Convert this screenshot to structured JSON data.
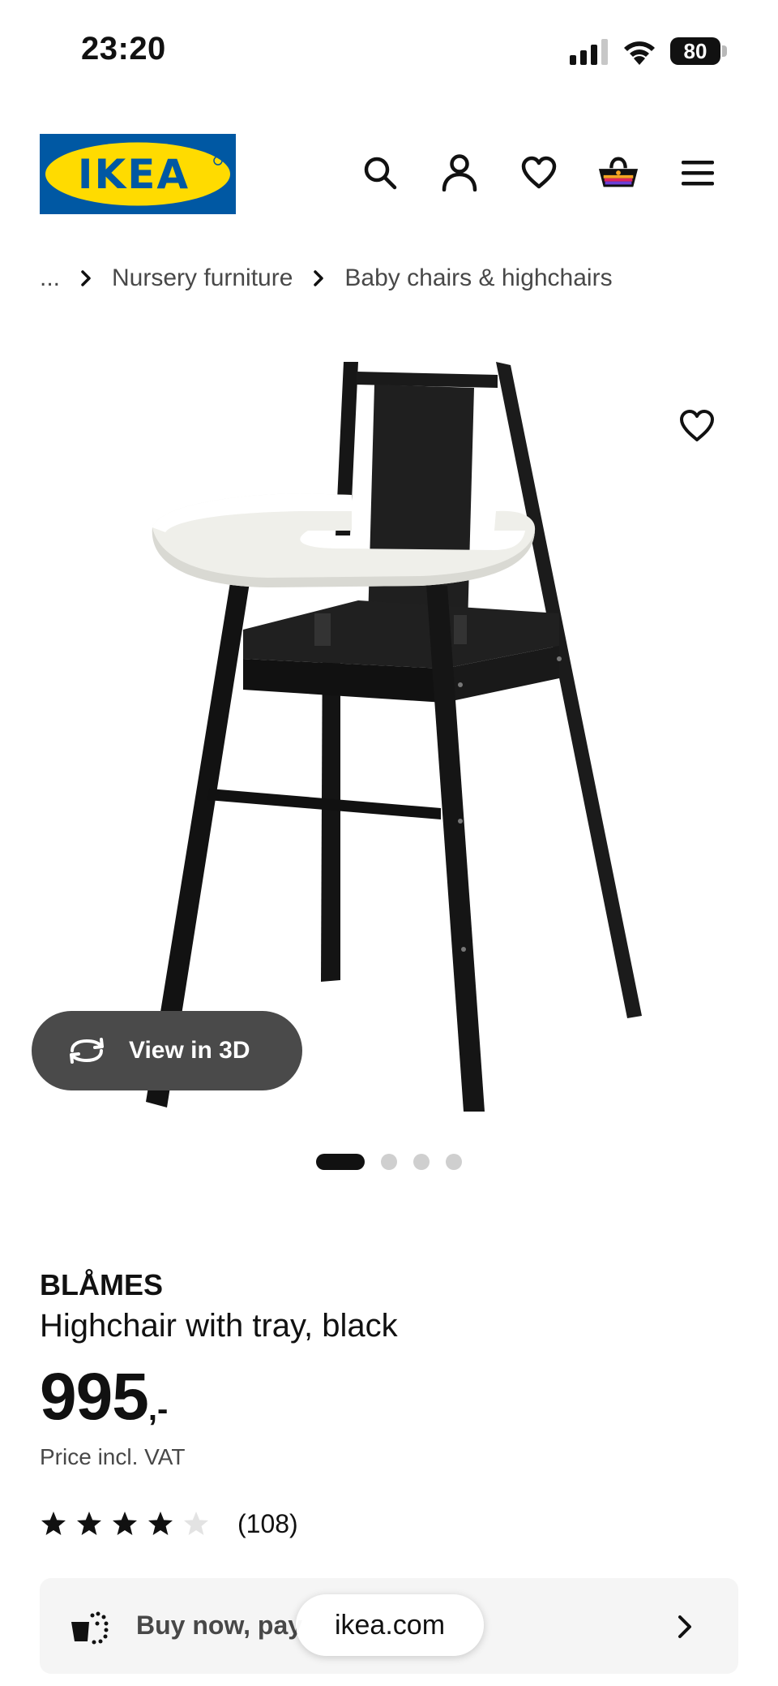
{
  "status_bar": {
    "time": "23:20",
    "battery": "80"
  },
  "header": {
    "logo_text": "IKEA",
    "icons": [
      "search-icon",
      "account-icon",
      "wishlist-icon",
      "cart-icon",
      "menu-icon"
    ]
  },
  "breadcrumb": {
    "items": [
      "...",
      "Nursery furniture",
      "Baby chairs & highchairs"
    ]
  },
  "gallery": {
    "view_3d_label": "View in 3D",
    "slide_count": 4,
    "active_slide": 1
  },
  "product": {
    "name": "BLÅMES",
    "description": "Highchair with tray, black",
    "price_integer": "995",
    "price_suffix": ",-",
    "price_note": "Price incl. VAT",
    "rating": 4,
    "rating_max": 5,
    "rating_count": "(108)"
  },
  "banner": {
    "text": "Buy now, pay"
  },
  "browser": {
    "url": "ikea.com"
  },
  "colors": {
    "ikea_blue": "#0058a3",
    "ikea_yellow": "#ffdb00",
    "text": "#111111",
    "muted": "#484848",
    "view3d_bg": "#4a4a4a"
  }
}
